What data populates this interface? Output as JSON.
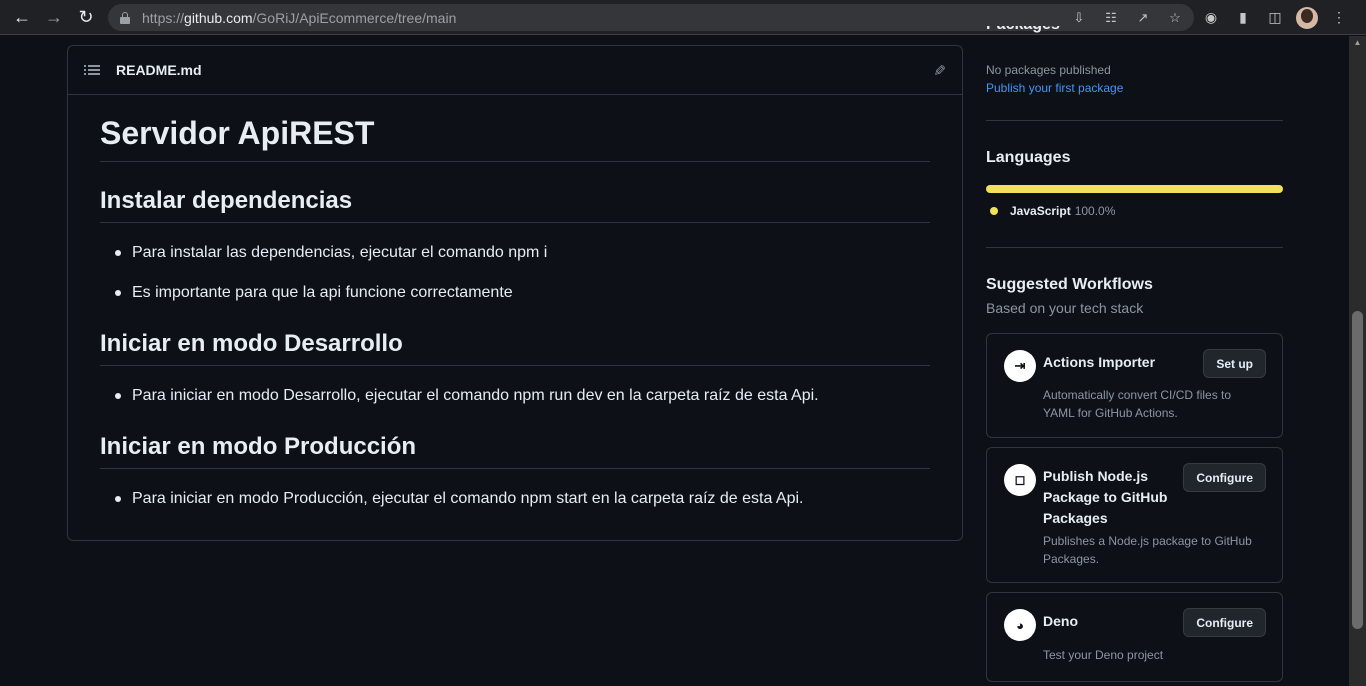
{
  "browser": {
    "url_scheme": "https://",
    "url_host": "github.com",
    "url_path": "/GoRiJ/ApiEcommerce/tree/main"
  },
  "readme": {
    "filename": "README.md",
    "h1": "Servidor ApiREST",
    "sections": [
      {
        "heading": "Instalar dependencias",
        "items": [
          "Para instalar las dependencias, ejecutar el comando npm i",
          "Es importante para que la api funcione correctamente"
        ]
      },
      {
        "heading": "Iniciar en modo Desarrollo",
        "items": [
          "Para iniciar en modo Desarrollo, ejecutar el comando npm run dev en la carpeta raíz de esta Api."
        ]
      },
      {
        "heading": "Iniciar en modo Producción",
        "items": [
          "Para iniciar en modo Producción, ejecutar el comando npm start en la carpeta raíz de esta Api."
        ]
      }
    ]
  },
  "sidebar": {
    "packages": {
      "title": "Packages",
      "empty_text": "No packages published",
      "link": "Publish your first package"
    },
    "languages": {
      "title": "Languages",
      "items": [
        {
          "name": "JavaScript",
          "percent": "100.0%",
          "color": "#f1e05a"
        }
      ]
    },
    "workflows": {
      "title": "Suggested Workflows",
      "subtitle": "Based on your tech stack",
      "cards": [
        {
          "name": "Actions Importer",
          "button": "Set up",
          "description": "Automatically convert CI/CD files to YAML for GitHub Actions.",
          "icon": "actions-importer-icon"
        },
        {
          "name": "Publish Node.js Package to GitHub Packages",
          "button": "Configure",
          "description": "Publishes a Node.js package to GitHub Packages.",
          "icon": "package-icon"
        },
        {
          "name": "Deno",
          "button": "Configure",
          "description": "Test your Deno project",
          "icon": "deno-icon"
        }
      ]
    }
  },
  "colors": {
    "background": "#0d1117",
    "border": "#30363d",
    "link": "#4493f8",
    "javascript": "#f1e05a"
  }
}
